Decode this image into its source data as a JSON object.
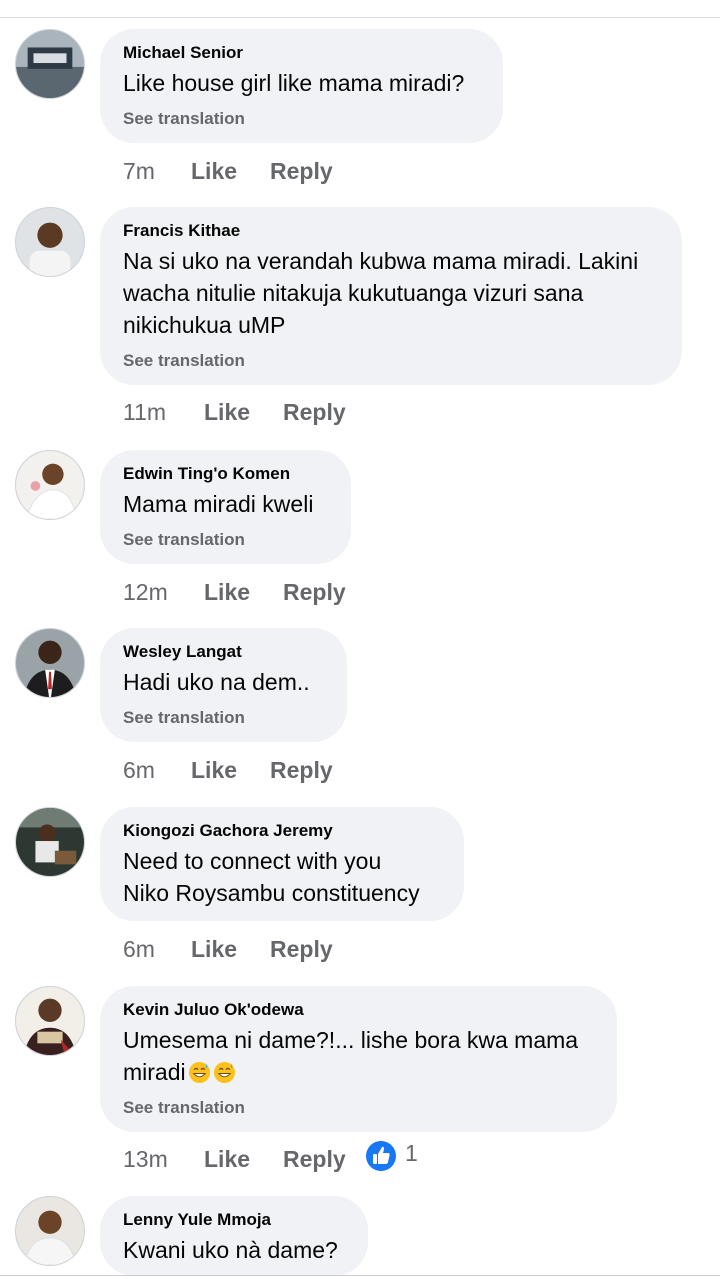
{
  "comments": [
    {
      "author": "Michael Senior",
      "text": "Like house girl like mama miradi?",
      "see_translation": "See translation",
      "time": "7m",
      "like": "Like",
      "reply": "Reply"
    },
    {
      "author": "Francis Kithae",
      "text": "Na si uko na verandah kubwa mama miradi. Lakini\nwacha nitulie nitakuja kukutuanga vizuri sana\nnikichukua uMP",
      "see_translation": "See translation",
      "time": "11m",
      "like": "Like",
      "reply": "Reply"
    },
    {
      "author": "Edwin Ting'o Komen",
      "text": "Mama miradi kweli",
      "see_translation": "See translation",
      "time": "12m",
      "like": "Like",
      "reply": "Reply"
    },
    {
      "author": "Wesley Langat",
      "text": "Hadi uko na dem..",
      "see_translation": "See translation",
      "time": "6m",
      "like": "Like",
      "reply": "Reply"
    },
    {
      "author": "Kiongozi Gachora Jeremy",
      "text": "Need to connect with you\nNiko Roysambu constituency",
      "time": "6m",
      "like": "Like",
      "reply": "Reply"
    },
    {
      "author": "Kevin Juluo Ok'odewa",
      "text_line1": "Umesema ni dame?!... lishe bora kwa mama",
      "text_line2": "miradi",
      "see_translation": "See translation",
      "time": "13m",
      "like": "Like",
      "reply": "Reply",
      "reaction_count": "1",
      "reaction_icon": "thumbs-up-icon",
      "emoji_icon": "grinning-sweat-emoji"
    },
    {
      "author": "Lenny Yule Mmoja",
      "text": "Kwani uko nà dame?"
    }
  ],
  "colors": {
    "bubble": "#f0f2f5",
    "secondary_text": "#65676b",
    "primary_text": "#050505",
    "like_blue": "#1877f2"
  }
}
